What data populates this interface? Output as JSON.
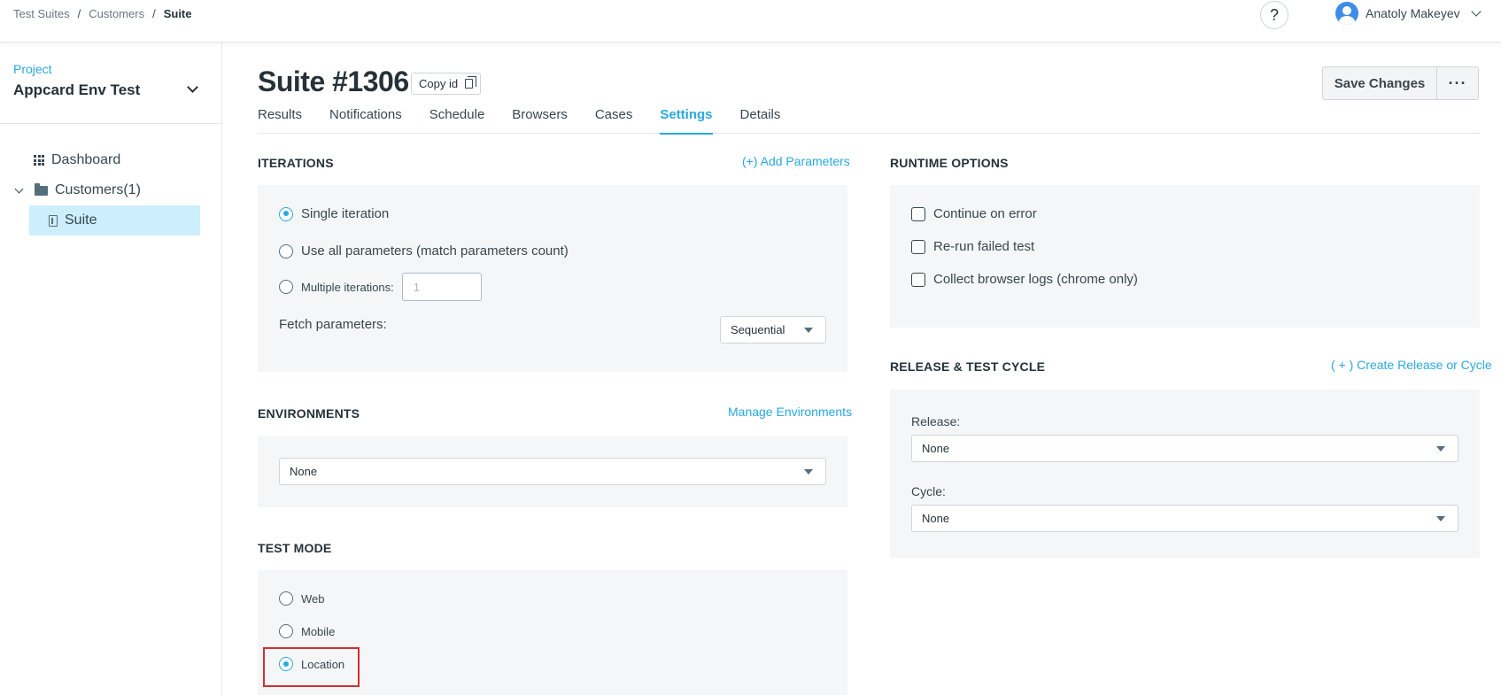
{
  "breadcrumb": {
    "items": [
      "Test Suites",
      "Customers",
      "Suite"
    ],
    "separator": "/"
  },
  "header": {
    "help_label": "?",
    "user_name": "Anatoly Makeyev"
  },
  "sidebar": {
    "project_label": "Project",
    "project_name": "Appcard Env Test",
    "items": [
      {
        "label": "Dashboard",
        "icon": "grid-icon"
      },
      {
        "label": "Customers(1)",
        "icon": "folder-icon"
      },
      {
        "label": "Suite",
        "icon": "suite-icon",
        "selected": true
      }
    ]
  },
  "page": {
    "title": "Suite #1306",
    "copy_id_label": "Copy id",
    "save_label": "Save Changes",
    "more_label": "···"
  },
  "tabs": [
    {
      "label": "Results"
    },
    {
      "label": "Notifications"
    },
    {
      "label": "Schedule"
    },
    {
      "label": "Browsers"
    },
    {
      "label": "Cases"
    },
    {
      "label": "Settings",
      "active": true
    },
    {
      "label": "Details"
    }
  ],
  "iterations": {
    "title": "ITERATIONS",
    "link": "(+) Add Parameters",
    "options": [
      {
        "label": "Single iteration",
        "checked": true
      },
      {
        "label": "Use all parameters (match parameters count)",
        "checked": false
      },
      {
        "label": "Multiple iterations:",
        "checked": false
      }
    ],
    "multiple_placeholder": "1",
    "fetch_label": "Fetch parameters:",
    "fetch_value": "Sequential"
  },
  "environments": {
    "title": "ENVIRONMENTS",
    "link": "Manage Environments",
    "value": "None"
  },
  "test_mode": {
    "title": "TEST MODE",
    "options": [
      {
        "label": "Web",
        "checked": false
      },
      {
        "label": "Mobile",
        "checked": false
      },
      {
        "label": "Location",
        "checked": true
      }
    ]
  },
  "runtime": {
    "title": "RUNTIME OPTIONS",
    "options": [
      {
        "label": "Continue on error",
        "checked": false
      },
      {
        "label": "Re-run failed test",
        "checked": false
      },
      {
        "label": "Collect browser logs (chrome only)",
        "checked": false
      }
    ]
  },
  "release": {
    "title": "RELEASE & TEST CYCLE",
    "link": "( + ) Create Release or Cycle",
    "release_label": "Release:",
    "release_value": "None",
    "cycle_label": "Cycle:",
    "cycle_value": "None"
  },
  "colors": {
    "accent": "#29a8df",
    "highlight": "#d32f2f"
  }
}
